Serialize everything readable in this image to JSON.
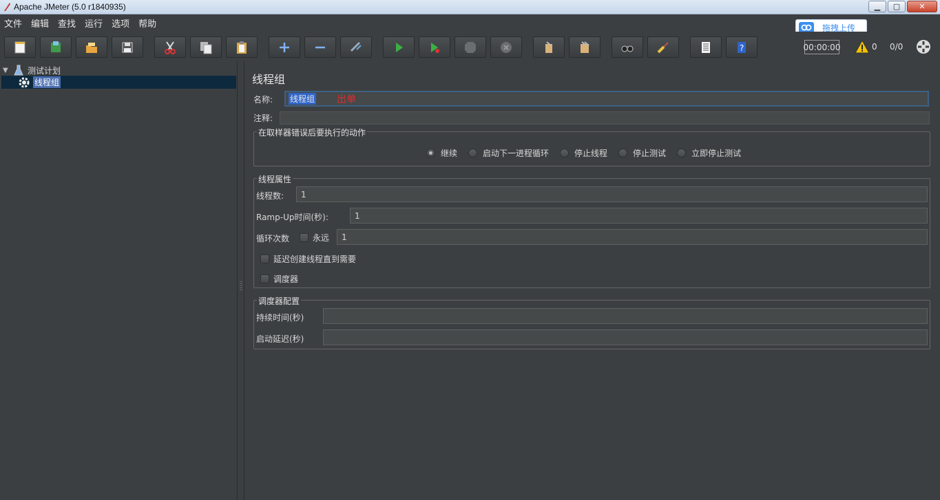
{
  "window": {
    "title": "Apache JMeter (5.0 r1840935)",
    "min_label": "▁",
    "max_label": "▢",
    "close_label": "✕"
  },
  "menu": [
    "文件",
    "编辑",
    "查找",
    "运行",
    "选项",
    "帮助"
  ],
  "upload_badge": {
    "label": "拖拽上传",
    "color": "#3a8ef0"
  },
  "toolbar": {
    "buttons": [
      "new-icon",
      "templates-icon",
      "open-icon",
      "save-icon",
      "cut-icon",
      "copy-icon",
      "paste-icon",
      "expand-icon",
      "collapse-icon",
      "toggle-icon",
      "start-icon",
      "start-no-pause-icon",
      "stop-icon",
      "shutdown-icon",
      "clear-icon",
      "clear-all-icon",
      "search-icon",
      "reset-search-icon",
      "function-helper-icon",
      "help-icon"
    ],
    "timer": "00:00:00",
    "warning_count": "0",
    "thread_count": "0/0"
  },
  "tree": {
    "root_label": "测试计划",
    "child_label": "线程组"
  },
  "panel": {
    "title": "线程组",
    "name_label": "名称:",
    "name_value": "线程组",
    "name_annotation": "出单",
    "comment_label": "注释:",
    "error_action": {
      "legend": "在取样器错误后要执行的动作",
      "options": [
        "继续",
        "启动下一进程循环",
        "停止线程",
        "停止测试",
        "立即停止测试"
      ],
      "selected": "继续"
    },
    "thread_props": {
      "legend": "线程属性",
      "threads_label": "线程数:",
      "threads_value": "1",
      "rampup_label": "Ramp-Up时间(秒):",
      "rampup_value": "1",
      "loop_label": "循环次数",
      "forever_label": "永远",
      "loop_value": "1",
      "delay_label": "延迟创建线程直到需要",
      "scheduler_label": "调度器"
    },
    "scheduler_config": {
      "legend": "调度器配置",
      "duration_label": "持续时间(秒)",
      "startup_delay_label": "启动延迟(秒)"
    }
  }
}
